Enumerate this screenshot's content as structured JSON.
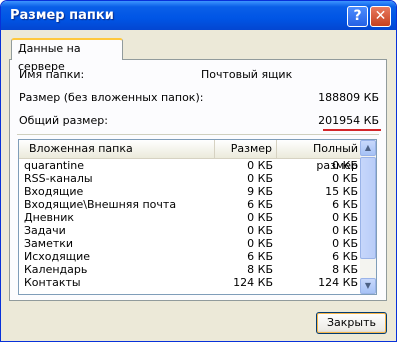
{
  "window": {
    "title": "Размер папки",
    "help_glyph": "?",
    "close_glyph": "✕"
  },
  "tab": {
    "label": "Данные на сервере"
  },
  "info": {
    "folder_name_label": "Имя папки:",
    "folder_name_value": "Почтовый ящик",
    "size_label": "Размер (без вложенных папок):",
    "size_value": "188809 КБ",
    "total_label": "Общий размер:",
    "total_value": "201954 КБ"
  },
  "table": {
    "columns": [
      "Вложенная папка",
      "Размер",
      "Полный размер"
    ],
    "rows": [
      {
        "name": "quarantine",
        "size": "0 КБ",
        "total": "0 КБ"
      },
      {
        "name": "RSS-каналы",
        "size": "0 КБ",
        "total": "0 КБ"
      },
      {
        "name": "Входящие",
        "size": "9 КБ",
        "total": "15 КБ"
      },
      {
        "name": "Входящие\\Внешняя почта",
        "size": "6 КБ",
        "total": "6 КБ"
      },
      {
        "name": "Дневник",
        "size": "0 КБ",
        "total": "0 КБ"
      },
      {
        "name": "Задачи",
        "size": "0 КБ",
        "total": "0 КБ"
      },
      {
        "name": "Заметки",
        "size": "0 КБ",
        "total": "0 КБ"
      },
      {
        "name": "Исходящие",
        "size": "6 КБ",
        "total": "6 КБ"
      },
      {
        "name": "Календарь",
        "size": "8 КБ",
        "total": "8 КБ"
      },
      {
        "name": "Контакты",
        "size": "124 КБ",
        "total": "124 КБ"
      }
    ]
  },
  "buttons": {
    "close_label": "Закрыть"
  },
  "colors": {
    "title_blue": "#0055e5",
    "underline_red": "#d3262a"
  }
}
